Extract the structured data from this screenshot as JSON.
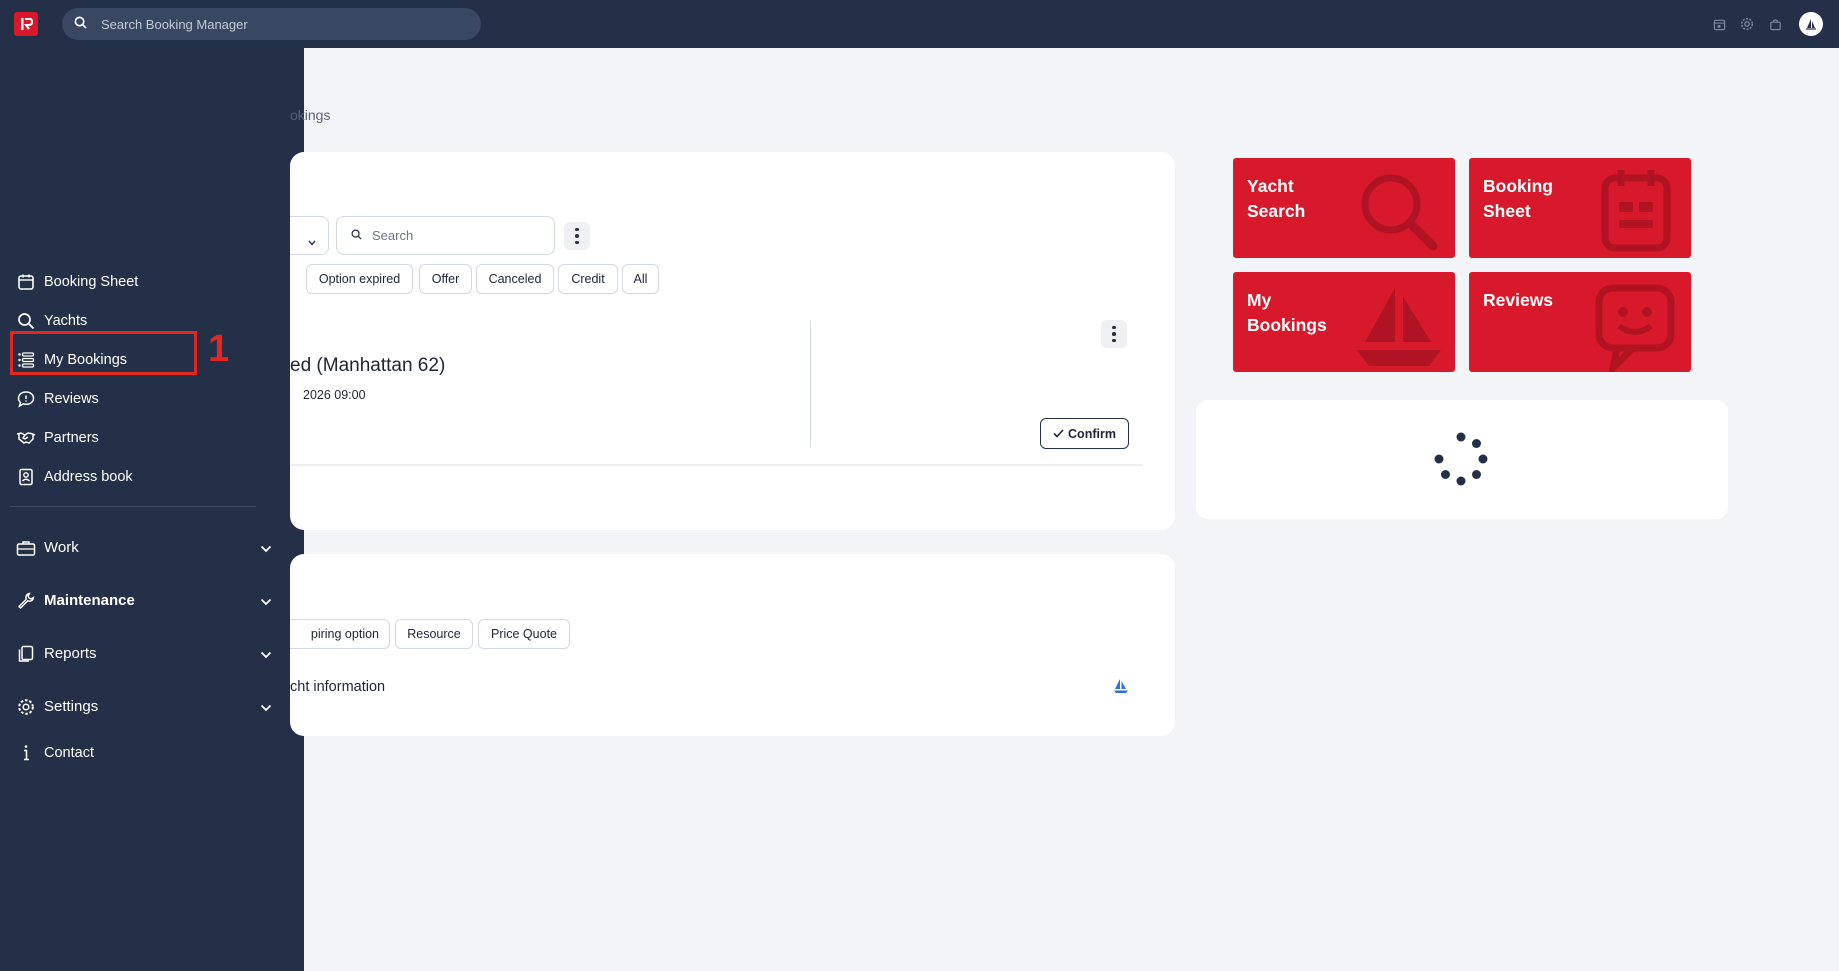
{
  "topbar": {
    "search_placeholder": "Search Booking Manager",
    "logo_icon": "booking-manager-logo",
    "icons": [
      "calendar-icon",
      "gear-icon",
      "shopping-bag-icon",
      "avatar-icon"
    ]
  },
  "sidebar": {
    "items": [
      {
        "label": "Booking Sheet",
        "icon": "calendar-icon"
      },
      {
        "label": "Yachts",
        "icon": "search-icon"
      },
      {
        "label": "My Bookings",
        "icon": "list-icon"
      },
      {
        "label": "Reviews",
        "icon": "speech-bubble-icon"
      },
      {
        "label": "Partners",
        "icon": "handshake-icon"
      },
      {
        "label": "Address book",
        "icon": "contact-card-icon"
      }
    ],
    "groups": [
      {
        "label": "Work",
        "icon": "briefcase-icon"
      },
      {
        "label": "Maintenance",
        "icon": "wrench-icon"
      },
      {
        "label": "Reports",
        "icon": "documents-icon"
      },
      {
        "label": "Settings",
        "icon": "gear-icon"
      }
    ],
    "contact": {
      "label": "Contact",
      "icon": "info-icon"
    }
  },
  "annotation": {
    "number": "1",
    "color": "#e3261f"
  },
  "main": {
    "breadcrumb": "okings",
    "search_placeholder": "Search",
    "filter_chips": [
      "Option expired",
      "Offer",
      "Canceled",
      "Credit",
      "All"
    ],
    "booking": {
      "title": "ed (Manhattan 62)",
      "date": "2026 09:00",
      "confirm_label": "Confirm"
    },
    "card2": {
      "chips": [
        "piring option",
        "Resource",
        "Price Quote"
      ],
      "yacht_info": "cht information"
    }
  },
  "tiles": [
    {
      "label": "Yacht Search",
      "line1": "Yacht",
      "line2": "Search",
      "icon": "magnifier-icon"
    },
    {
      "label": "Booking Sheet",
      "line1": "Booking",
      "line2": "Sheet",
      "icon": "calendar-icon"
    },
    {
      "label": "My Bookings",
      "line1": "My",
      "line2": "Bookings",
      "icon": "sailboat-icon"
    },
    {
      "label": "Reviews",
      "line1": "Reviews",
      "line2": "",
      "icon": "smiley-bubble-icon"
    }
  ],
  "colors": {
    "sidebar_bg": "#243047",
    "tile_red": "#d8182b",
    "page_bg": "#f3f4f7",
    "annotation_red": "#e3261f"
  }
}
